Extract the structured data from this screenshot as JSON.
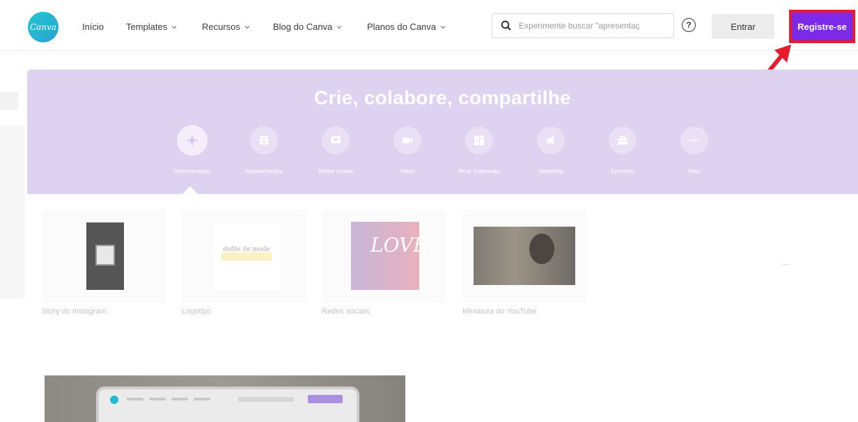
{
  "nav": {
    "logo_text": "Canva",
    "items": [
      {
        "label": "Início",
        "has_dropdown": false
      },
      {
        "label": "Templates",
        "has_dropdown": true
      },
      {
        "label": "Recursos",
        "has_dropdown": true
      },
      {
        "label": "Blog do Canva",
        "has_dropdown": true
      },
      {
        "label": "Planos do Canva",
        "has_dropdown": true
      }
    ],
    "search_placeholder": "Experimente buscar \"apresentaç",
    "help_icon": "?",
    "login_label": "Entrar",
    "signup_label": "Registre-se"
  },
  "hero": {
    "title": "Crie, colabore, compartilhe",
    "categories": [
      {
        "label": "Recomendado",
        "icon": "sparkle-icon",
        "active": true
      },
      {
        "label": "Apresentações",
        "icon": "presentation-icon",
        "active": false
      },
      {
        "label": "Redes sociais",
        "icon": "heart-chat-icon",
        "active": false
      },
      {
        "label": "Vídeo",
        "icon": "video-camera-icon",
        "active": false
      },
      {
        "label": "Prod. impressão",
        "icon": "print-products-icon",
        "active": false
      },
      {
        "label": "Marketing",
        "icon": "megaphone-icon",
        "active": false
      },
      {
        "label": "Escritório",
        "icon": "briefcase-icon",
        "active": false
      },
      {
        "label": "Mais",
        "icon": "more-dots-icon",
        "active": false
      }
    ]
  },
  "templates": [
    {
      "label": "Story do Instagram"
    },
    {
      "label": "Logotipo",
      "thumb_text": "defile de mode"
    },
    {
      "label": "Redes sociais",
      "thumb_text": "LOVE"
    },
    {
      "label": "Miniatura do YouTube"
    }
  ],
  "colors": {
    "brand_purple": "#7d2ae8",
    "highlight_red": "#e61c2c",
    "hero_bg": "#ddd2ef",
    "logo_teal": "#22c8cf"
  }
}
